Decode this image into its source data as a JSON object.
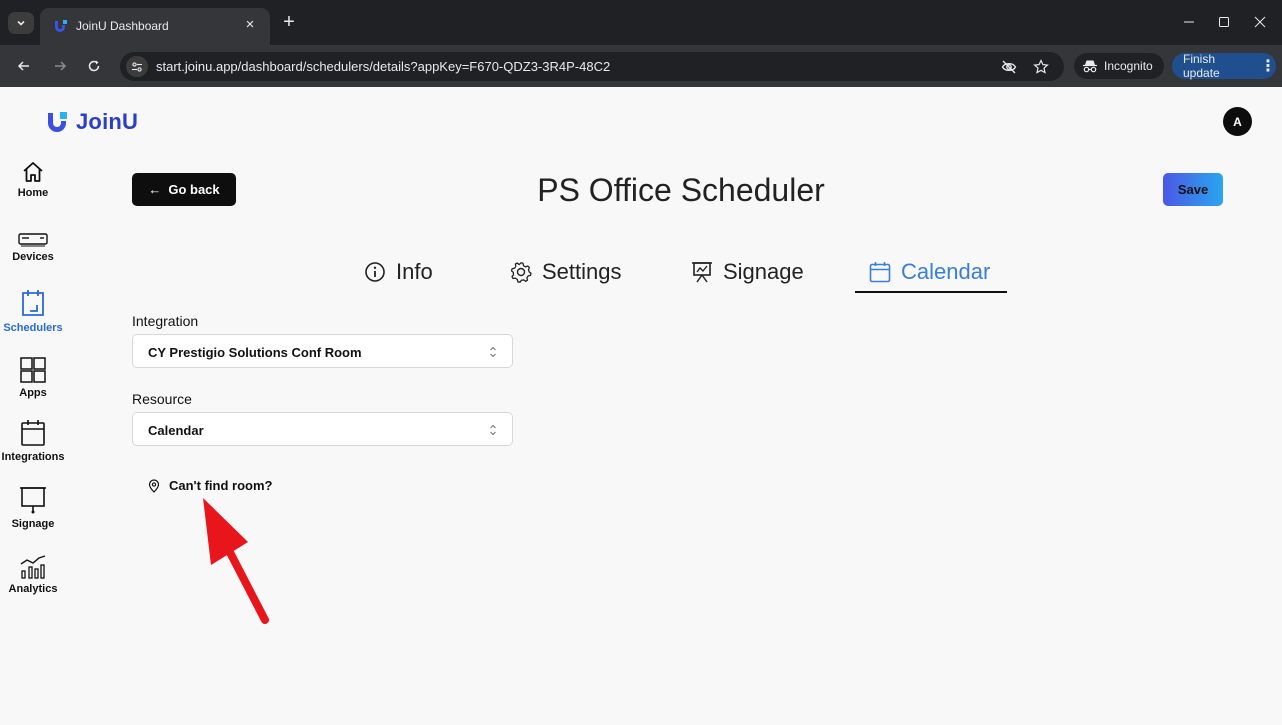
{
  "browser": {
    "tab_title": "JoinU Dashboard",
    "url": "start.joinu.app/dashboard/schedulers/details?appKey=F670-QDZ3-3R4P-48C2",
    "incognito_label": "Incognito",
    "finish_update_label": "Finish update"
  },
  "app": {
    "logo_text": "JoinU",
    "avatar_initial": "A",
    "brand_color": "#2a3ec8"
  },
  "sidebar": {
    "items": [
      {
        "label": "Home",
        "icon": "home-icon"
      },
      {
        "label": "Devices",
        "icon": "device-icon"
      },
      {
        "label": "Schedulers",
        "icon": "scheduler-icon",
        "active": true
      },
      {
        "label": "Apps",
        "icon": "apps-grid-icon"
      },
      {
        "label": "Integrations",
        "icon": "calendar-icon"
      },
      {
        "label": "Signage",
        "icon": "signage-board-icon"
      },
      {
        "label": "Analytics",
        "icon": "analytics-icon"
      }
    ]
  },
  "header": {
    "back_label": "Go back",
    "title": "PS Office Scheduler",
    "save_label": "Save"
  },
  "tabs": [
    {
      "label": "Info",
      "icon": "info-icon"
    },
    {
      "label": "Settings",
      "icon": "gear-icon"
    },
    {
      "label": "Signage",
      "icon": "presentation-icon"
    },
    {
      "label": "Calendar",
      "icon": "calendar-icon",
      "active": true
    }
  ],
  "form": {
    "integration_label": "Integration",
    "integration_value": "CY Prestigio Solutions Conf Room",
    "resource_label": "Resource",
    "resource_value": "Calendar",
    "cant_find_label": "Can't find room?"
  },
  "annotation": {
    "color": "#e8151b",
    "icon": "red-arrow-annotation"
  }
}
